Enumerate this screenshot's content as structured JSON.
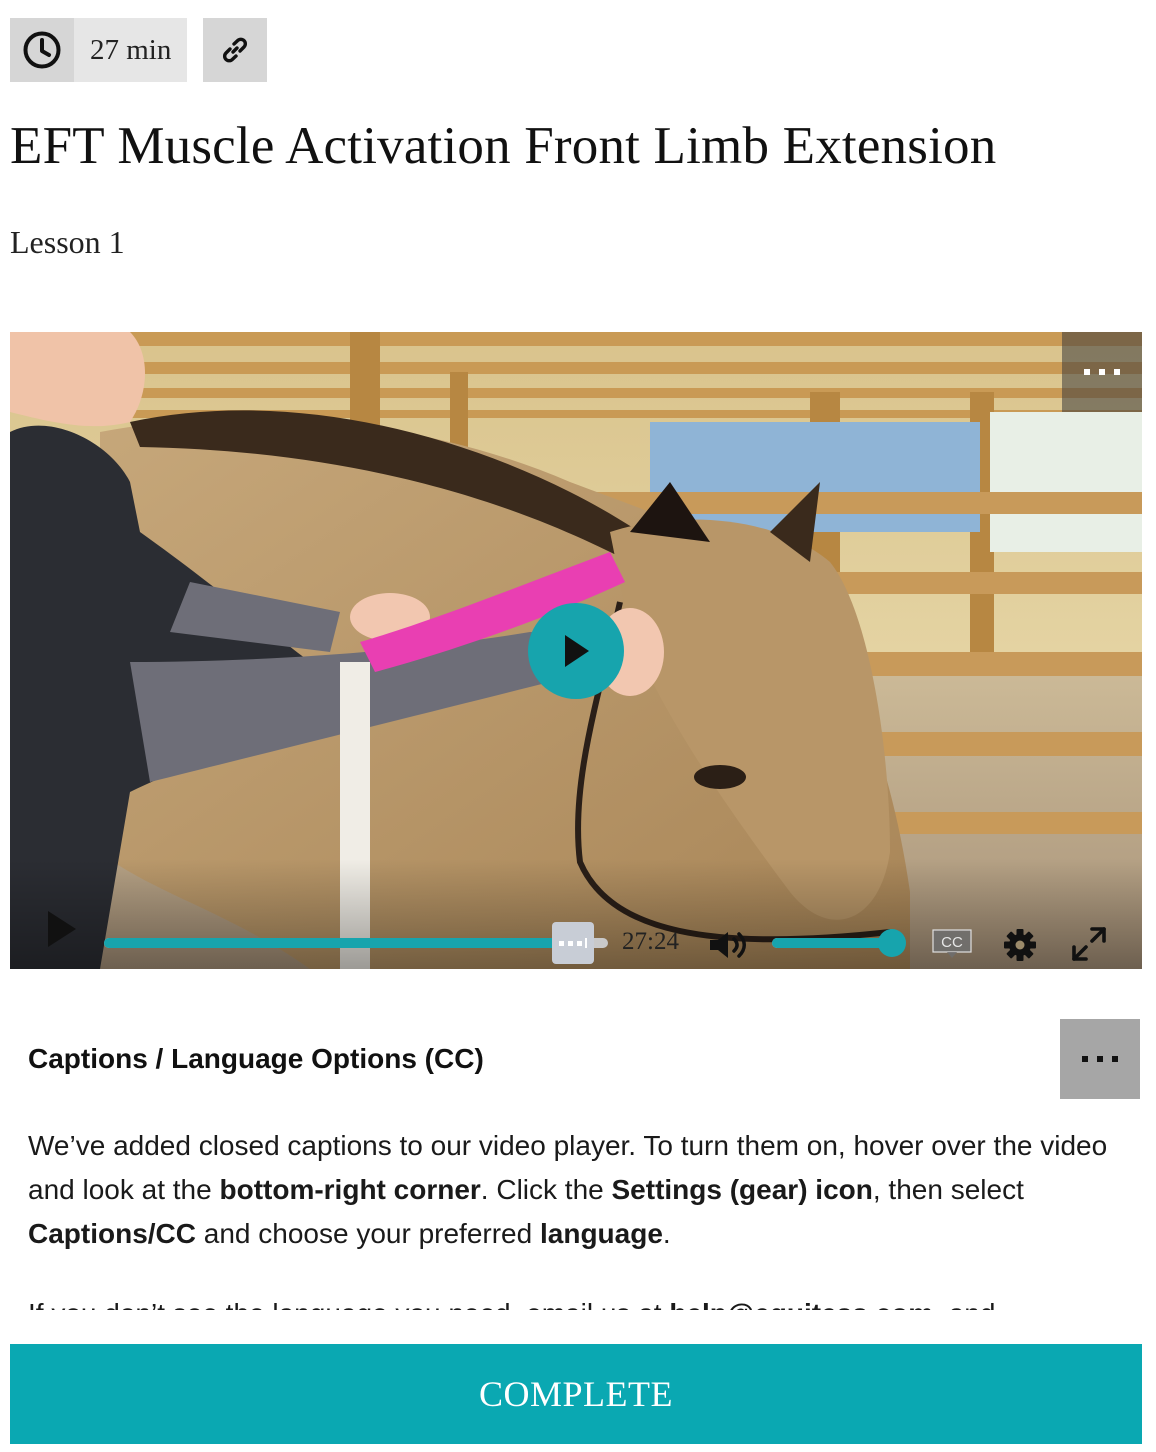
{
  "meta": {
    "duration": "27 min",
    "clock_icon": "clock-icon",
    "link_icon": "link-icon"
  },
  "lesson": {
    "title": "EFT Muscle Activation Front Limb Extension",
    "subtitle": "Lesson 1"
  },
  "video": {
    "time": "27:24",
    "progress_fraction": 0.93,
    "volume_fraction": 1.0,
    "accent": "#17a4ad",
    "icons": [
      "more-icon",
      "play-icon",
      "volume-icon",
      "cc-icon",
      "gear-icon",
      "fullscreen-icon"
    ]
  },
  "captions_section": {
    "heading": "Captions / Language Options (CC)",
    "para1": {
      "t1": "We’ve added closed captions to our video player. To turn them on, hover over the video and look at the ",
      "b1": "bottom-right corner",
      "t2": ". Click the ",
      "b2": "Settings (gear) icon",
      "t3": ", then select ",
      "b3": "Captions/CC",
      "t4": " and choose your preferred ",
      "b4": "language",
      "t5": "."
    },
    "para2": {
      "t1": "If you don’t see the language you need, email us at ",
      "b1": "help@equitess.com",
      "t2": ", and"
    }
  },
  "footer": {
    "complete_label": "COMPLETE",
    "color": "#0aa8b2"
  }
}
